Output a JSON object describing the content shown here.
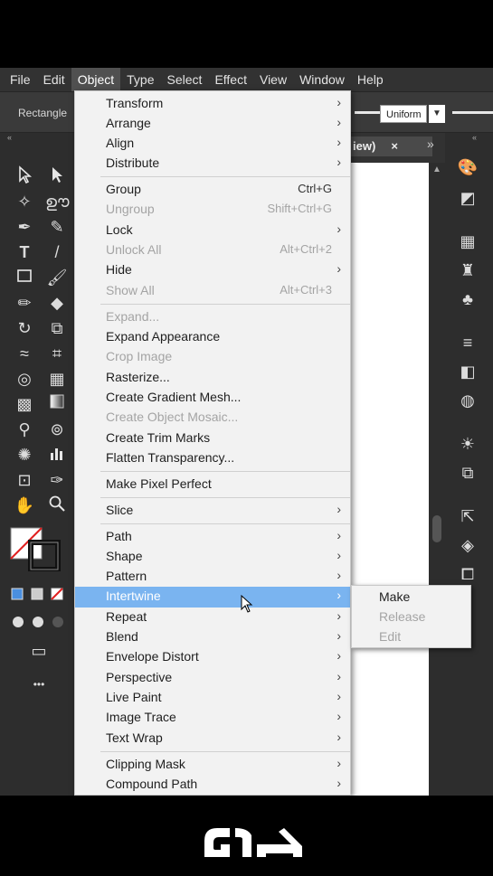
{
  "menubar": {
    "items": [
      "File",
      "Edit",
      "Object",
      "Type",
      "Select",
      "Effect",
      "View",
      "Window",
      "Help"
    ],
    "active": "Object"
  },
  "controlbar": {
    "tool_label": "Rectangle",
    "stroke_profile": "Uniform"
  },
  "document": {
    "tab_title": "iew)",
    "close_glyph": "×",
    "tab_arrows": "»"
  },
  "object_menu": {
    "transform": "Transform",
    "arrange": "Arrange",
    "align": "Align",
    "distribute": "Distribute",
    "group": {
      "label": "Group",
      "shortcut": "Ctrl+G"
    },
    "ungroup": {
      "label": "Ungroup",
      "shortcut": "Shift+Ctrl+G"
    },
    "lock": "Lock",
    "unlock_all": {
      "label": "Unlock All",
      "shortcut": "Alt+Ctrl+2"
    },
    "hide": "Hide",
    "show_all": {
      "label": "Show All",
      "shortcut": "Alt+Ctrl+3"
    },
    "expand": "Expand...",
    "expand_appearance": "Expand Appearance",
    "crop_image": "Crop Image",
    "rasterize": "Rasterize...",
    "create_gradient_mesh": "Create Gradient Mesh...",
    "create_object_mosaic": "Create Object Mosaic...",
    "create_trim_marks": "Create Trim Marks",
    "flatten_transparency": "Flatten Transparency...",
    "make_pixel_perfect": "Make Pixel Perfect",
    "slice": "Slice",
    "path": "Path",
    "shape": "Shape",
    "pattern": "Pattern",
    "intertwine": "Intertwine",
    "repeat": "Repeat",
    "blend": "Blend",
    "envelope_distort": "Envelope Distort",
    "perspective": "Perspective",
    "live_paint": "Live Paint",
    "image_trace": "Image Trace",
    "text_wrap": "Text Wrap",
    "clipping_mask": "Clipping Mask",
    "compound_path": "Compound Path"
  },
  "intertwine_submenu": {
    "make": "Make",
    "release": "Release",
    "edit": "Edit"
  },
  "ui": {
    "submenu_arrow": "›",
    "more_tools": "•••",
    "collapse_left": "«",
    "collapse_right": "«"
  },
  "colors": {
    "app_bg": "#323232",
    "menu_bg": "#f2f2f2",
    "highlight": "#7ab4f0",
    "disabled_text": "#a4a4a4"
  }
}
